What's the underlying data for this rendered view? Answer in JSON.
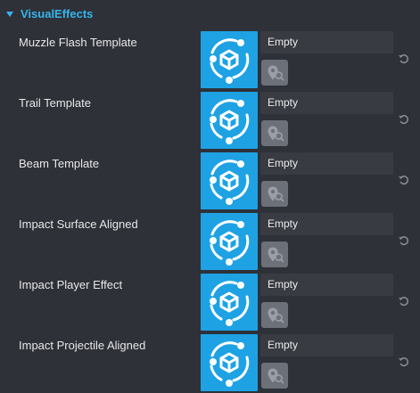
{
  "section": {
    "title": "VisualEffects",
    "expanded": true,
    "accent_color": "#36b4ec"
  },
  "asset_icon": {
    "name": "effect-template-icon",
    "background_color": "#1ea2e4"
  },
  "rows": [
    {
      "label": "Muzzle Flash Template",
      "value": "Empty"
    },
    {
      "label": "Trail Template",
      "value": "Empty"
    },
    {
      "label": "Beam Template",
      "value": "Empty"
    },
    {
      "label": "Impact Surface Aligned",
      "value": "Empty"
    },
    {
      "label": "Impact Player Effect",
      "value": "Empty"
    },
    {
      "label": "Impact Projectile Aligned",
      "value": "Empty"
    }
  ]
}
